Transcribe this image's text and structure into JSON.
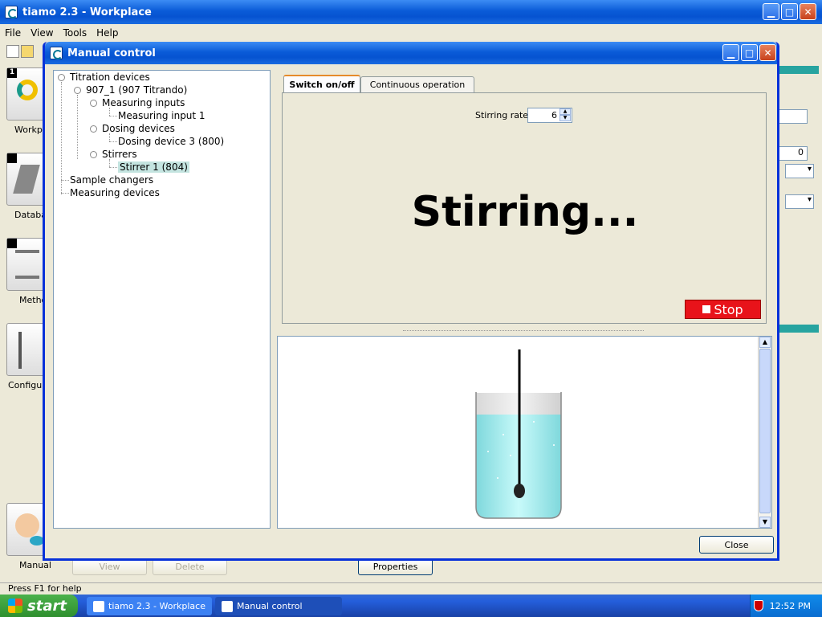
{
  "main_window": {
    "title": "tiamo 2.3 - Workplace",
    "menu": [
      "File",
      "View",
      "Tools",
      "Help"
    ],
    "nav": [
      {
        "label": "Workpla",
        "badge": "1"
      },
      {
        "label": "Databa"
      },
      {
        "label": "Metho"
      },
      {
        "label": "Configur"
      },
      {
        "label": "Manual"
      }
    ],
    "bg_field_value": "0",
    "bottom_buttons": {
      "view": "View",
      "delete": "Delete",
      "properties": "Properties"
    },
    "status": "Press F1 for help"
  },
  "dialog": {
    "title": "Manual control",
    "tree": {
      "root": "Titration devices",
      "device": "907_1 (907 Titrando)",
      "measuring_inputs": "Measuring inputs",
      "measuring_input_1": "Measuring input 1",
      "dosing_devices": "Dosing devices",
      "dosing_device_3": "Dosing device 3 (800)",
      "stirrers": "Stirrers",
      "stirrer_1": "Stirrer 1 (804)",
      "sample_changers": "Sample changers",
      "measuring_devices": "Measuring devices"
    },
    "tabs": {
      "switch": "Switch on/off",
      "continuous": "Continuous operation"
    },
    "stirring_rate_label": "Stirring rate",
    "stirring_rate_value": "6",
    "status_text": "Stirring...",
    "stop_label": "Stop",
    "close_label": "Close",
    "colors": {
      "stop": "#e8131a",
      "liquid": "#a8eef0",
      "selection": "#c4e4e0"
    }
  },
  "taskbar": {
    "start": "start",
    "tasks": [
      "tiamo 2.3 - Workplace",
      "Manual control"
    ],
    "time": "12:52 PM"
  }
}
